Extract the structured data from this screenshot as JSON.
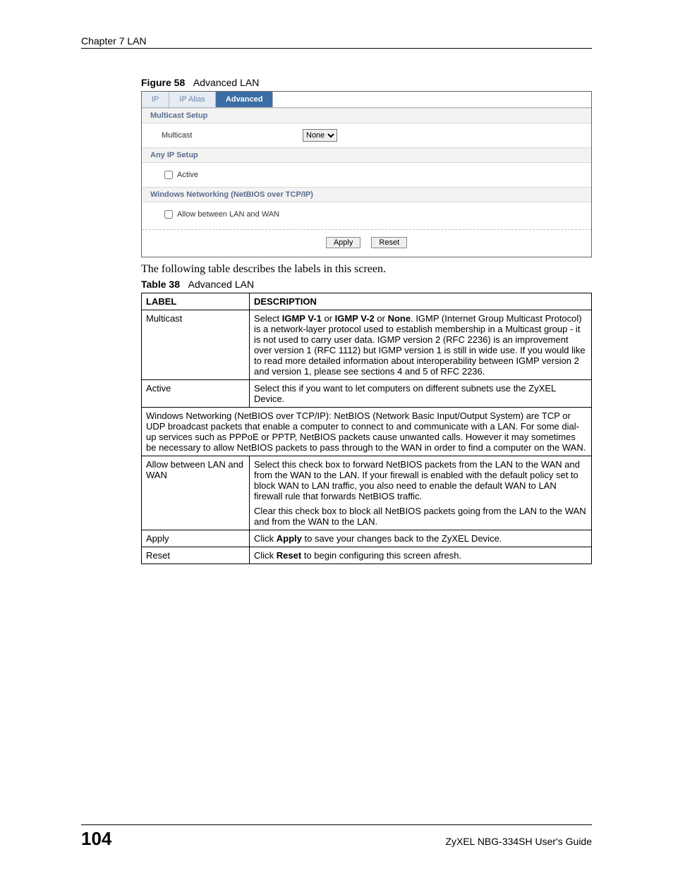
{
  "header": {
    "running_head": "Chapter 7 LAN"
  },
  "figure": {
    "label": "Figure 58",
    "title": "Advanced LAN"
  },
  "shot": {
    "tabs": {
      "ip": "IP",
      "ip_alias": "IP Alias",
      "advanced": "Advanced"
    },
    "sections": {
      "multicast_setup": "Multicast Setup",
      "any_ip_setup": "Any IP Setup",
      "netbios": "Windows Networking (NetBIOS over TCP/IP)"
    },
    "labels": {
      "multicast": "Multicast",
      "active": "Active",
      "allow": "Allow between LAN and WAN"
    },
    "multicast_selected": "None",
    "buttons": {
      "apply": "Apply",
      "reset": "Reset"
    }
  },
  "bodytext": "The following table describes the labels in this screen.",
  "table_caption": {
    "label": "Table 38",
    "title": "Advanced LAN"
  },
  "table": {
    "head": {
      "label": "LABEL",
      "desc": "DESCRIPTION"
    },
    "rows": {
      "multicast": {
        "label": "Multicast",
        "desc_pre": "Select ",
        "b1": "IGMP V-1",
        "mid1": " or ",
        "b2": "IGMP V-2",
        "mid2": " or ",
        "b3": "None",
        "desc_post": ". IGMP (Internet Group Multicast Protocol) is a network-layer protocol used to establish membership in a Multicast group - it is not used to carry user data. IGMP version 2 (RFC 2236) is an improvement over version 1 (RFC 1112) but IGMP version 1 is still in wide use. If you would like to read more detailed information about interoperability between IGMP version 2 and version 1, please see sections 4 and 5 of RFC 2236."
      },
      "active": {
        "label": "Active",
        "desc": "Select this if you want to let computers on different subnets use the ZyXEL Device."
      },
      "netbios_span": "Windows Networking (NetBIOS over TCP/IP): NetBIOS (Network Basic Input/Output System) are TCP or UDP broadcast packets that enable a computer to connect to and communicate with a LAN. For some dial-up services such as PPPoE or PPTP, NetBIOS packets cause unwanted calls. However it may sometimes be necessary to allow NetBIOS packets to pass through to the WAN in order to find a computer on the WAN.",
      "allow": {
        "label": "Allow between LAN and WAN",
        "p1": "Select this check box to forward NetBIOS packets from the LAN to the WAN and from the WAN to the LAN. If your firewall is enabled with the default policy set to block WAN to LAN traffic, you also need to enable the default WAN to LAN firewall rule that forwards NetBIOS traffic.",
        "p2": "Clear this check box to block all NetBIOS packets going from the LAN to the WAN and from the WAN to the LAN."
      },
      "apply": {
        "label": "Apply",
        "pre": "Click ",
        "b": "Apply",
        "post": " to save your changes back to the ZyXEL Device."
      },
      "reset": {
        "label": "Reset",
        "pre": "Click ",
        "b": "Reset",
        "post": " to begin configuring this screen afresh."
      }
    }
  },
  "footer": {
    "page": "104",
    "guide": "ZyXEL NBG-334SH User's Guide"
  }
}
